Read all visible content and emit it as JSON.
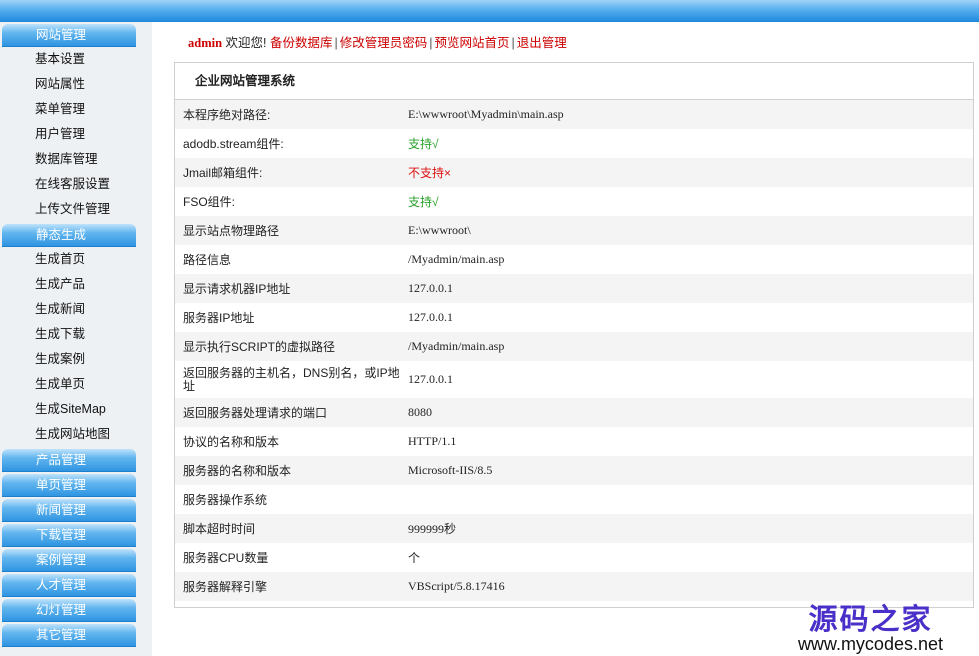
{
  "nav": {
    "username": "admin",
    "welcome": "欢迎您!",
    "links": [
      "备份数据库",
      "修改管理员密码",
      "预览网站首页",
      "退出管理"
    ],
    "separator": "|"
  },
  "sidebar": {
    "groups": [
      {
        "label": "网站管理",
        "items": [
          "基本设置",
          "网站属性",
          "菜单管理",
          "用户管理",
          "数据库管理",
          "在线客服设置",
          "上传文件管理"
        ]
      },
      {
        "label": "静态生成",
        "items": [
          "生成首页",
          "生成产品",
          "生成新闻",
          "生成下载",
          "生成案例",
          "生成单页",
          "生成SiteMap",
          "生成网站地图"
        ]
      },
      {
        "label": "产品管理",
        "items": []
      },
      {
        "label": "单页管理",
        "items": []
      },
      {
        "label": "新闻管理",
        "items": []
      },
      {
        "label": "下载管理",
        "items": []
      },
      {
        "label": "案例管理",
        "items": []
      },
      {
        "label": "人才管理",
        "items": []
      },
      {
        "label": "幻灯管理",
        "items": []
      },
      {
        "label": "其它管理",
        "items": []
      }
    ]
  },
  "panel": {
    "title": "企业网站管理系统",
    "rows": [
      {
        "key": "本程序绝对路径:",
        "value": "E:\\wwwroot\\Myadmin\\main.asp"
      },
      {
        "key": "adodb.stream组件:",
        "value": "支持√"
      },
      {
        "key": "Jmail邮箱组件:",
        "value": "不支持×"
      },
      {
        "key": "FSO组件:",
        "value": "支持√"
      },
      {
        "key": "显示站点物理路径",
        "value": "E:\\wwwroot\\"
      },
      {
        "key": "路径信息",
        "value": "/Myadmin/main.asp"
      },
      {
        "key": "显示请求机器IP地址",
        "value": "127.0.0.1"
      },
      {
        "key": "服务器IP地址",
        "value": "127.0.0.1"
      },
      {
        "key": "显示执行SCRIPT的虚拟路径",
        "value": "/Myadmin/main.asp"
      },
      {
        "key": "返回服务器的主机名，DNS别名，或IP地址",
        "value": "127.0.0.1"
      },
      {
        "key": "返回服务器处理请求的端口",
        "value": "8080"
      },
      {
        "key": "协议的名称和版本",
        "value": "HTTP/1.1"
      },
      {
        "key": "服务器的名称和版本",
        "value": "Microsoft-IIS/8.5"
      },
      {
        "key": "服务器操作系统",
        "value": ""
      },
      {
        "key": "脚本超时时间",
        "value": "999999秒"
      },
      {
        "key": "服务器CPU数量",
        "value": "个"
      },
      {
        "key": "服务器解释引擎",
        "value": "VBScript/5.8.17416"
      }
    ]
  },
  "watermark": {
    "cn": "源码之家",
    "url": "www.mycodes.net"
  },
  "colors": {
    "accent_blue": "#2f94e2",
    "link_red": "#cc0000",
    "ok_green": "#2aa12a",
    "error_red": "#dd1111",
    "watermark_purple": "#4a2fc9"
  }
}
